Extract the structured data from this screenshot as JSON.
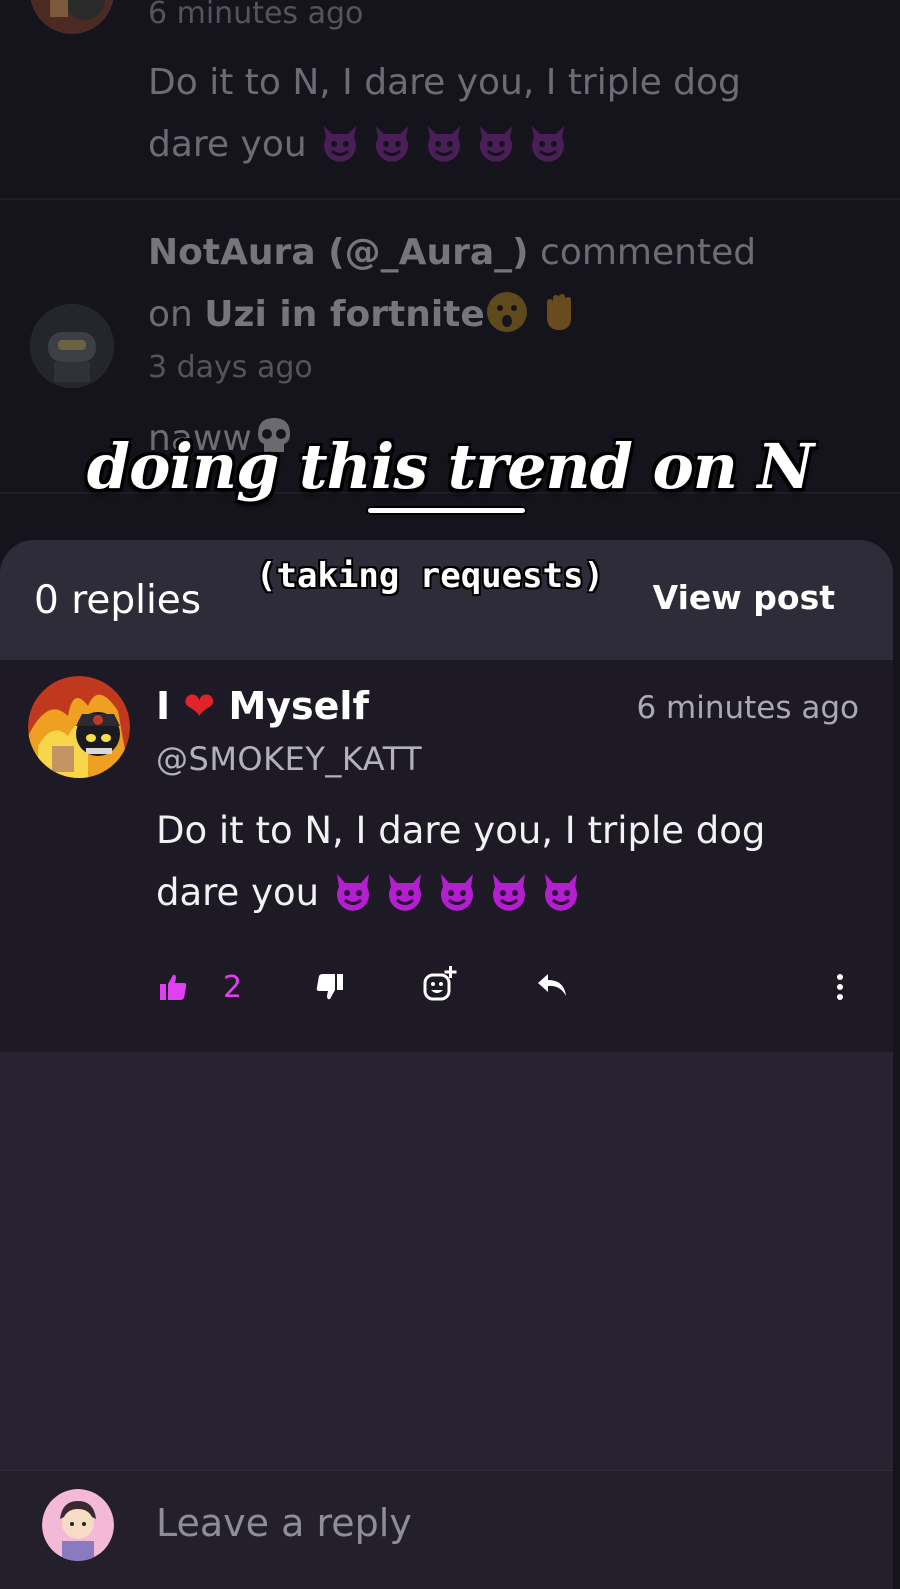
{
  "background_feed": {
    "item1": {
      "time": "6 minutes ago",
      "body_line1": "Do it to N, I dare you, I triple dog",
      "body_line2": "dare you"
    },
    "item2": {
      "user": "NotAura (@_Aura_)",
      "action": "commented",
      "on_word": "on",
      "post_title": "Uzi in fortnite",
      "time": "3 days ago",
      "body": "naww"
    }
  },
  "overlay": {
    "caption_main": "doing this trend on N",
    "caption_sub": "(taking requests)"
  },
  "sheet": {
    "replies_label": "0 replies",
    "view_post_label": "View post"
  },
  "comment": {
    "name_prefix": "I",
    "name_heart": "❤",
    "name_suffix": "Myself",
    "time": "6 minutes ago",
    "handle": "@SMOKEY_KATT",
    "body_line1": "Do it to N, I dare you, I triple dog",
    "body_line2": "dare you",
    "like_count": "2"
  },
  "footer": {
    "reply_placeholder": "Leave a reply"
  },
  "colors": {
    "accent": "#e040f2",
    "background": "#15141c",
    "sheet": "#272331",
    "comment_bg": "#1d1a25",
    "devil_emoji": "#b31fd0"
  },
  "icons": [
    "thumbs-up-icon",
    "thumbs-down-icon",
    "add-reaction-icon",
    "reply-icon",
    "more-vertical-icon",
    "devil-emoji-icon",
    "skull-emoji-icon",
    "frowning-emoji-icon",
    "raised-hand-emoji-icon"
  ]
}
